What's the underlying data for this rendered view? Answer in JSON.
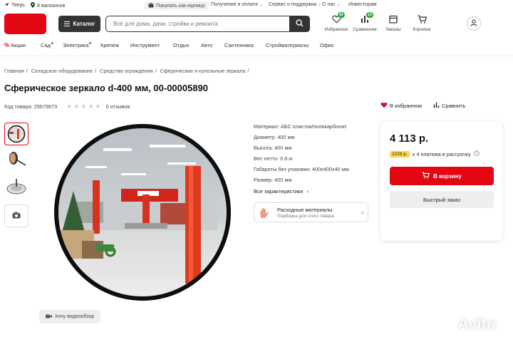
{
  "topbar": {
    "city": "Тверь",
    "stores": "8 магазинов",
    "legal": "Покупать как юрлицо",
    "links": [
      "Получение и оплата",
      "Сервис и поддержка",
      "О нас",
      "Инвесторам"
    ]
  },
  "header": {
    "catalog_label": "Каталог",
    "search_placeholder": "Всё для дома, дачи, стройки и ремонта",
    "favorites": {
      "label": "Избранное",
      "badge": "43"
    },
    "compare": {
      "label": "Сравнение",
      "badge": "13"
    },
    "orders_label": "Заказы",
    "cart_label": "Корзина"
  },
  "categories": [
    "Акции",
    "Сад",
    "Электрика",
    "Крепеж",
    "Инструмент",
    "Отдых",
    "Авто",
    "Сантехника",
    "Стройматериалы",
    "Офис"
  ],
  "breadcrumb": [
    "Главная",
    "Складское оборудование",
    "Средства ограждения",
    "Сферические и купольные зеркала"
  ],
  "product": {
    "title": "Сферическое зеркало d-400 мм, 00-00005890",
    "code": "Код товара: 25679073",
    "rating_count": "0",
    "reviews": "отзывов",
    "favorite_label": "В избранном",
    "compare_label": "Сравнить",
    "video_label": "Хочу видеообзор",
    "specs": [
      "Материал: АБС пластик/поликарбонат",
      "Диаметр: 400 мм",
      "Высота: 400 мм",
      "Вес нетто: 0.8 кг",
      "Габариты без упаковки: 400x400x40 мм",
      "Размер: 400 мм"
    ],
    "all_specs_label": "Все характеристики",
    "consumables_title": "Расходные материалы",
    "consumables_sub": "Подборка для этого товара"
  },
  "buy": {
    "price": "4 113 р.",
    "installment_amount": "1029 р.",
    "installment_text": "х 4 платежа в рассрочку",
    "cart_button": "В корзину",
    "quick_order": "Быстрый заказ"
  },
  "watermark": "Avito",
  "colors": {
    "brand_red": "#e30613",
    "badge_green": "#2aa745",
    "chip_yellow": "#fbd84c"
  }
}
